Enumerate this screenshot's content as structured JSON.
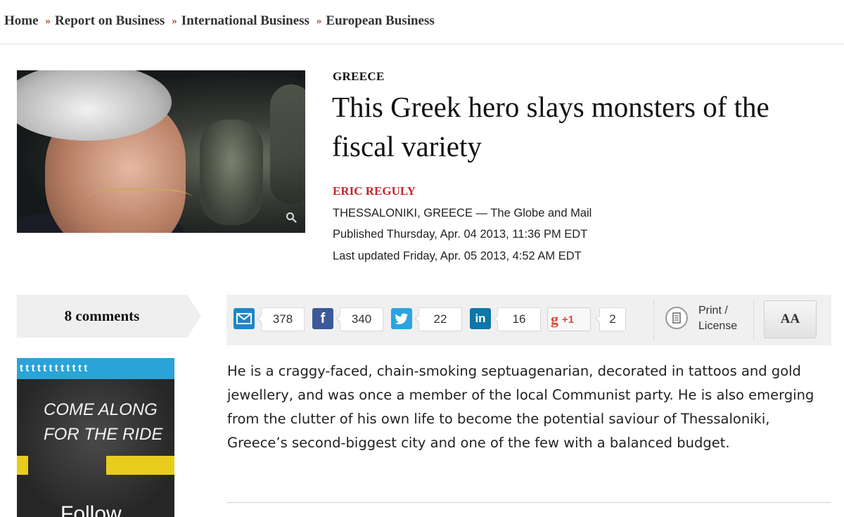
{
  "breadcrumb": {
    "items": [
      "Home",
      "Report on Business",
      "International Business",
      "European Business"
    ],
    "separator": "»"
  },
  "article": {
    "section": "GREECE",
    "headline_line1": "This Greek hero slays monsters of the",
    "headline_line2": "fiscal variety",
    "author": "ERIC REGULY",
    "dateline": "THESSALONIKI, GREECE — The Globe and Mail",
    "published": "Published Thursday, Apr. 04 2013, 11:36 PM EDT",
    "updated": "Last updated Friday, Apr. 05 2013, 4:52 AM EDT",
    "body": "He is a craggy-faced, chain-smoking septuagenarian, decorated in tattoos and gold jewellery, and was once a member of the local Communist party. He is also emerging from the clutter of his own life to become the potential saviour of Thessaloniki, Greece’s second-biggest city and one of the few with a balanced budget."
  },
  "comments": {
    "label": "8 comments"
  },
  "share": {
    "email_count": "378",
    "facebook_count": "340",
    "twitter_count": "22",
    "linkedin_count": "16",
    "gplus_label": "+1",
    "gplus_count": "2",
    "print_line1": "Print /",
    "print_line2": "License",
    "font_size_label": "AA"
  },
  "ad": {
    "strip": "tttttttttttt",
    "line1": "COME ALONG",
    "line2": "FOR THE RIDE",
    "follow": "Follow"
  },
  "colors": {
    "accent_red": "#c9252c",
    "email_blue": "#1f86c8",
    "facebook_blue": "#3b5998",
    "twitter_blue": "#2aa3e1",
    "linkedin_blue": "#0e76a8",
    "gplus_red": "#dd4b39",
    "ad_blue": "#2aa3d8",
    "ad_yellow": "#e8cc1e"
  }
}
